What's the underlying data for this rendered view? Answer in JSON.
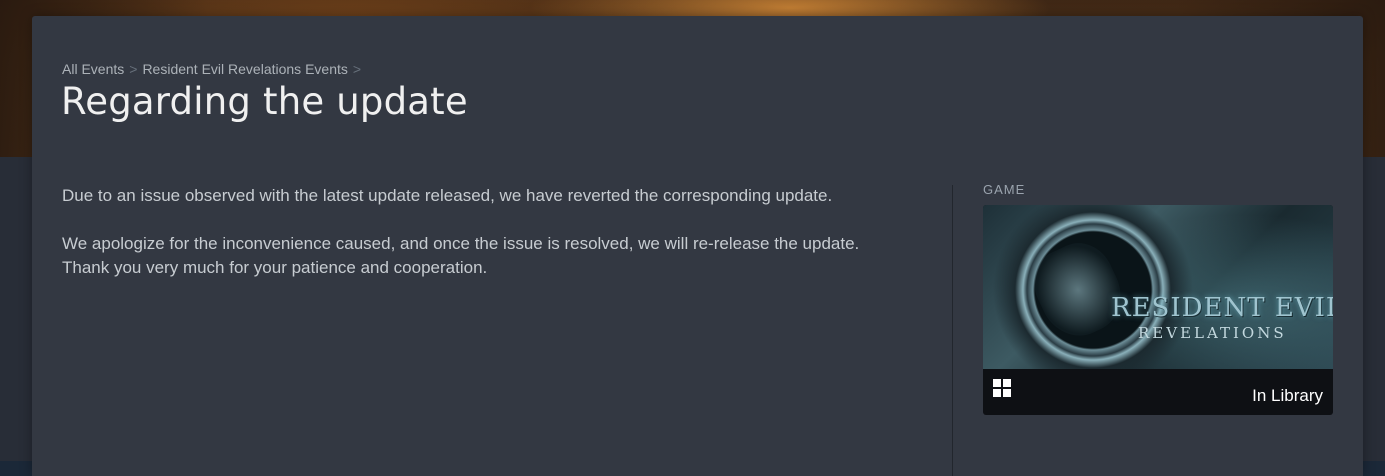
{
  "breadcrumb": {
    "items": [
      "All Events",
      "Resident Evil Revelations Events"
    ],
    "separator": ">"
  },
  "page_title": "Regarding the update",
  "body": {
    "paragraph_1": "Due to an issue observed with the latest update released, we have reverted the corresponding update.",
    "paragraph_2_line_1": "We apologize for the inconvenience caused, and once the issue is resolved, we will re-release the update.",
    "paragraph_2_line_2": "Thank you very much for your patience and cooperation."
  },
  "sidebar": {
    "section_label": "GAME",
    "game_card": {
      "art_title": "RESIDENT EVIL",
      "art_subtitle": "REVELATIONS",
      "platform_icon": "windows-icon",
      "status": "In Library"
    }
  }
}
